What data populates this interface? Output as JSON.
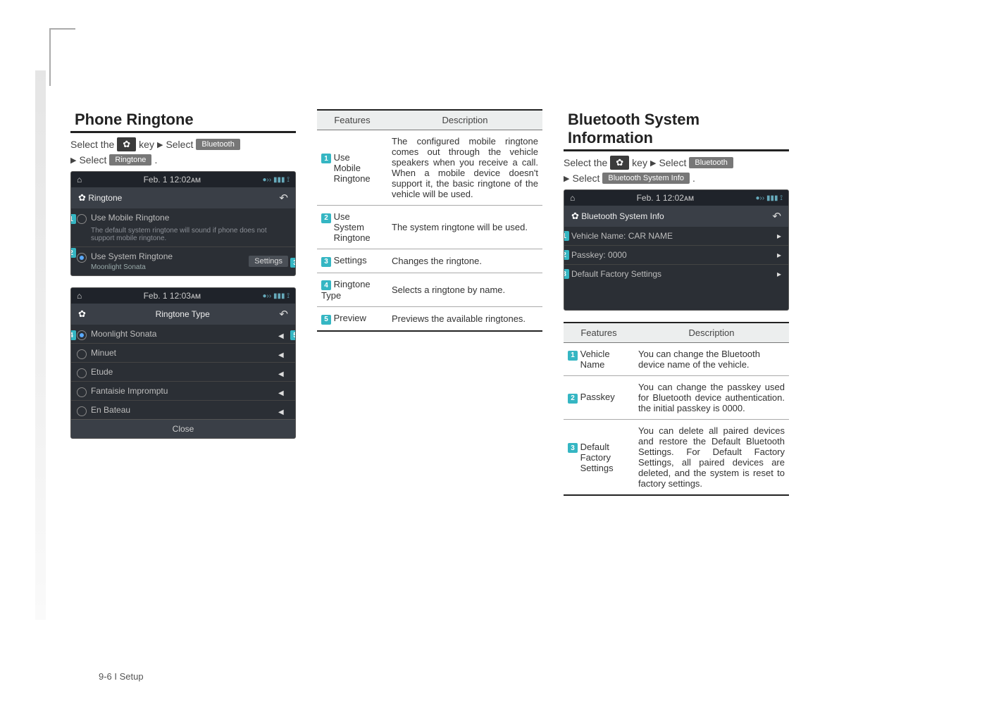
{
  "footer": "9-6 I Setup",
  "breadcrumb": {
    "select_the": "Select the",
    "key": "key",
    "arrow": "▶",
    "select": "Select",
    "bluetooth": "Bluetooth",
    "ringtone": "Ringtone",
    "bt_sys_info": "Bluetooth System Info"
  },
  "left": {
    "title": "Phone Ringtone",
    "shot1": {
      "time": "Feb. 1  12:02ᴀᴍ",
      "header": "Ringtone",
      "opt1": "Use Mobile Ringtone",
      "opt1_sub": "The default system ringtone will sound if phone does not support mobile ringtone.",
      "opt2": "Use System Ringtone",
      "opt2_sub": "Moonlight Sonata",
      "settings": "Settings"
    },
    "shot2": {
      "time": "Feb. 1  12:03ᴀᴍ",
      "header": "Ringtone Type",
      "items": [
        "Moonlight Sonata",
        "Minuet",
        "Etude",
        "Fantaisie Impromptu",
        "En Bateau"
      ],
      "close": "Close"
    }
  },
  "mid": {
    "th_feat": "Features",
    "th_desc": "Description",
    "rows": [
      {
        "n": "1",
        "f": "Use\nMobile\nRingtone",
        "d": "The configured mobile ringtone comes out through the vehicle speakers when you receive a call. When a mobile device doesn't support it, the basic ringtone of the vehicle will be used."
      },
      {
        "n": "2",
        "f": "Use\nSystem\nRingtone",
        "d": "The system ringtone will be used."
      },
      {
        "n": "3",
        "f": "Settings",
        "d": "Changes the ringtone."
      },
      {
        "n": "4",
        "f": "Ringtone Type",
        "d": "Selects a ringtone by name."
      },
      {
        "n": "5",
        "f": "Preview",
        "d": "Previews the available ringtones."
      }
    ]
  },
  "right": {
    "title": "Bluetooth System Information",
    "shot": {
      "time": "Feb. 1  12:02ᴀᴍ",
      "header": "Bluetooth System Info",
      "r1": "Vehicle Name: CAR NAME",
      "r2": "Passkey: 0000",
      "r3": "Default Factory Settings"
    },
    "th_feat": "Features",
    "th_desc": "Description",
    "rows": [
      {
        "n": "1",
        "f": "Vehicle\nName",
        "d": "You can change the Bluetooth device name of the vehicle."
      },
      {
        "n": "2",
        "f": "Passkey",
        "d": "You can change the passkey used for Bluetooth device authentication. the initial passkey is 0000."
      },
      {
        "n": "3",
        "f": "Default\nFactory\nSettings",
        "d": "You can delete all paired devices and restore the Default Bluetooth Settings. For Default Factory Settings, all paired devices are deleted, and the system is reset to factory settings."
      }
    ]
  }
}
